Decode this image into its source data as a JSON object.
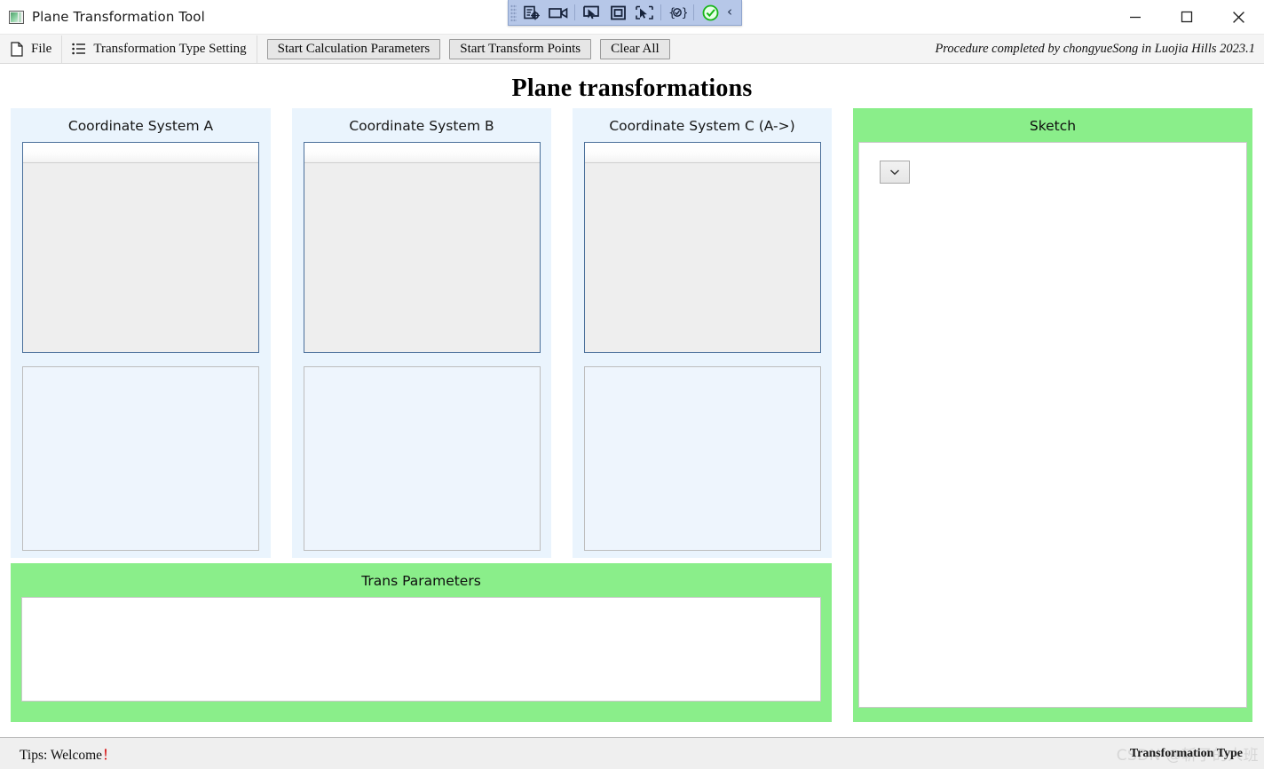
{
  "window": {
    "title": "Plane Transformation Tool",
    "icon": "app-icon",
    "minimize_label": "—",
    "maximize_label": "▢",
    "close_label": "✕"
  },
  "capture_toolbar": {
    "icons": [
      "capture-region-icon",
      "record-video-icon",
      "cursor-capture-icon",
      "window-capture-icon",
      "scroll-capture-icon",
      "settings-icon",
      "confirm-check-icon"
    ],
    "collapse_label": "‹"
  },
  "menubar": {
    "file": {
      "label": "File",
      "icon": "file-page-icon"
    },
    "transformation_type_setting": {
      "label": "Transformation Type Setting",
      "icon": "list-lines-icon"
    },
    "buttons": [
      {
        "label": "Start Calculation Parameters",
        "name": "start-calculation-parameters-button"
      },
      {
        "label": "Start Transform Points",
        "name": "start-transform-points-button"
      },
      {
        "label": "Clear All",
        "name": "clear-all-button"
      }
    ],
    "credit": "Procedure completed by chongyueSong in Luojia Hills 2023.1"
  },
  "main": {
    "page_title": "Plane transformations",
    "panels": [
      {
        "title": "Coordinate System A",
        "name": "coordinate-system-a"
      },
      {
        "title": "Coordinate System B",
        "name": "coordinate-system-b"
      },
      {
        "title": "Coordinate System C (A->)",
        "name": "coordinate-system-c"
      }
    ],
    "sketch": {
      "title": "Sketch",
      "dropdown_glyph": "⌄"
    },
    "trans_parameters": {
      "title": "Trans Parameters",
      "value": ""
    }
  },
  "statusbar": {
    "tips_prefix": "Tips:  Welcome",
    "tips_bang": "！",
    "hidden_label": "Transformation Type",
    "watermark": "CSDN @斩了的人班"
  },
  "colors": {
    "panel_blue": "#eaf4fd",
    "panel_green": "#8aee8a",
    "toolbar_blue": "#b6c7e8",
    "accent_border": "#4a6f9a",
    "bang_red": "#d40000"
  }
}
